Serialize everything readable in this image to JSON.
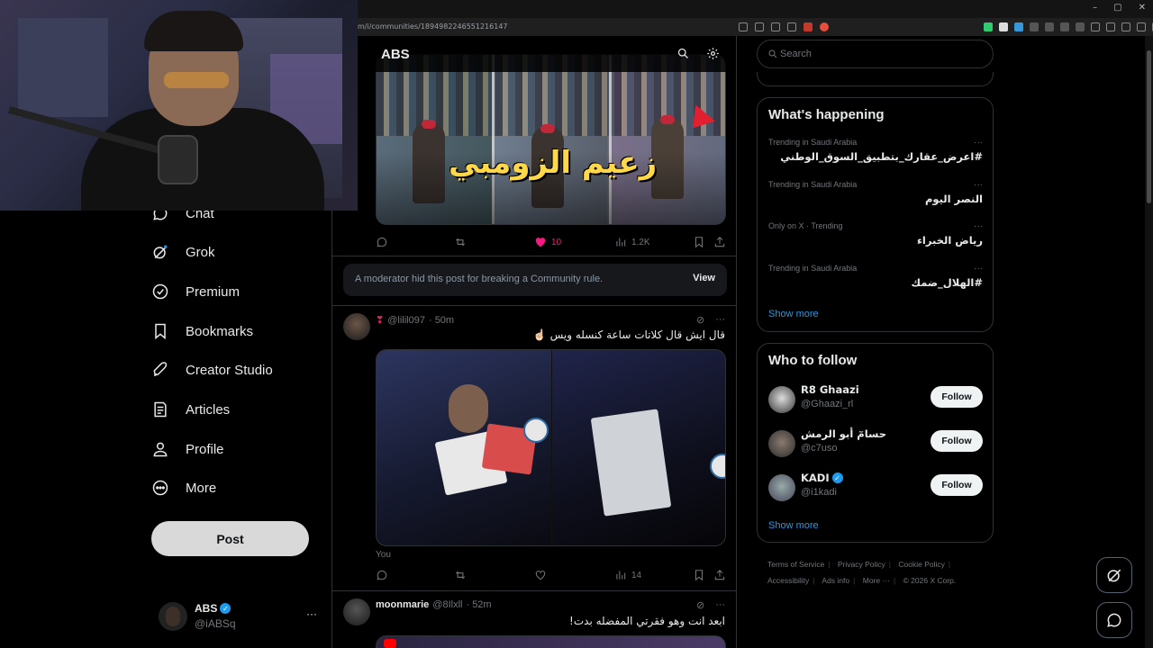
{
  "browser": {
    "url": "m/i/communities/1894982246551216147",
    "window_controls": [
      "–",
      "▢",
      "✕"
    ]
  },
  "community": {
    "title": "ABS"
  },
  "nav": {
    "items": [
      {
        "label": "Chat",
        "icon": "chat-icon"
      },
      {
        "label": "Grok",
        "icon": "grok-icon"
      },
      {
        "label": "Premium",
        "icon": "premium-icon"
      },
      {
        "label": "Bookmarks",
        "icon": "bookmark-icon"
      },
      {
        "label": "Creator Studio",
        "icon": "rocket-icon"
      },
      {
        "label": "Articles",
        "icon": "articles-icon"
      },
      {
        "label": "Profile",
        "icon": "profile-icon"
      },
      {
        "label": "More",
        "icon": "more-circle-icon"
      }
    ],
    "post_label": "Post"
  },
  "account": {
    "name": "ABS",
    "handle": "@iABSq",
    "more": "···"
  },
  "post1": {
    "overlay_text": "زعيم الزومبي",
    "stats": {
      "reply": "",
      "repost": "",
      "likes": "10",
      "views": "1.2K"
    },
    "like_color": "#f91880"
  },
  "moderation": {
    "text": "A moderator hid this post for breaking a Community rule.",
    "view_label": "View"
  },
  "post2": {
    "prefix": "❣",
    "handle": "@lilil097",
    "time": "· 50m",
    "text": "قال ايش قال كلاتات ساعة كنسله ويس ☝🏻",
    "caption": "You",
    "stats": {
      "views": "14"
    }
  },
  "post3": {
    "name": "moonmarie",
    "handle": "@8Ilxll",
    "time": "· 52m",
    "text": "ابعد انت وهو فقرتي المفضله بدت!"
  },
  "right": {
    "search_placeholder": "Search",
    "whats_happening": {
      "title": "What's happening",
      "trends": [
        {
          "meta": "Trending in Saudi Arabia",
          "name": "#اعرض_عقارك_بتطبيق_السوق_الوطني"
        },
        {
          "meta": "Trending in Saudi Arabia",
          "name": "النصر اليوم"
        },
        {
          "meta": "Only on X · Trending",
          "name": "رياض الخبراء"
        },
        {
          "meta": "Trending in Saudi Arabia",
          "name": "#الهلال_ضمك"
        }
      ],
      "show_more": "Show more"
    },
    "who_to_follow": {
      "title": "Who to follow",
      "accounts": [
        {
          "name": "R8 Ghaazi",
          "handle": "@Ghaazi_rl",
          "verified": false
        },
        {
          "name": "حسامٓ أبو الرمش",
          "handle": "@c7uso",
          "verified": false
        },
        {
          "name": "KADI",
          "handle": "@i1kadi",
          "verified": true
        }
      ],
      "follow_label": "Follow",
      "show_more": "Show more"
    },
    "footer": [
      "Terms of Service",
      "Privacy Policy",
      "Cookie Policy",
      "Accessibility",
      "Ads info",
      "More ···",
      "© 2026 X Corp."
    ]
  },
  "colors": {
    "accent": "#1d9bf0",
    "background": "#000000",
    "border": "#2f3336"
  }
}
